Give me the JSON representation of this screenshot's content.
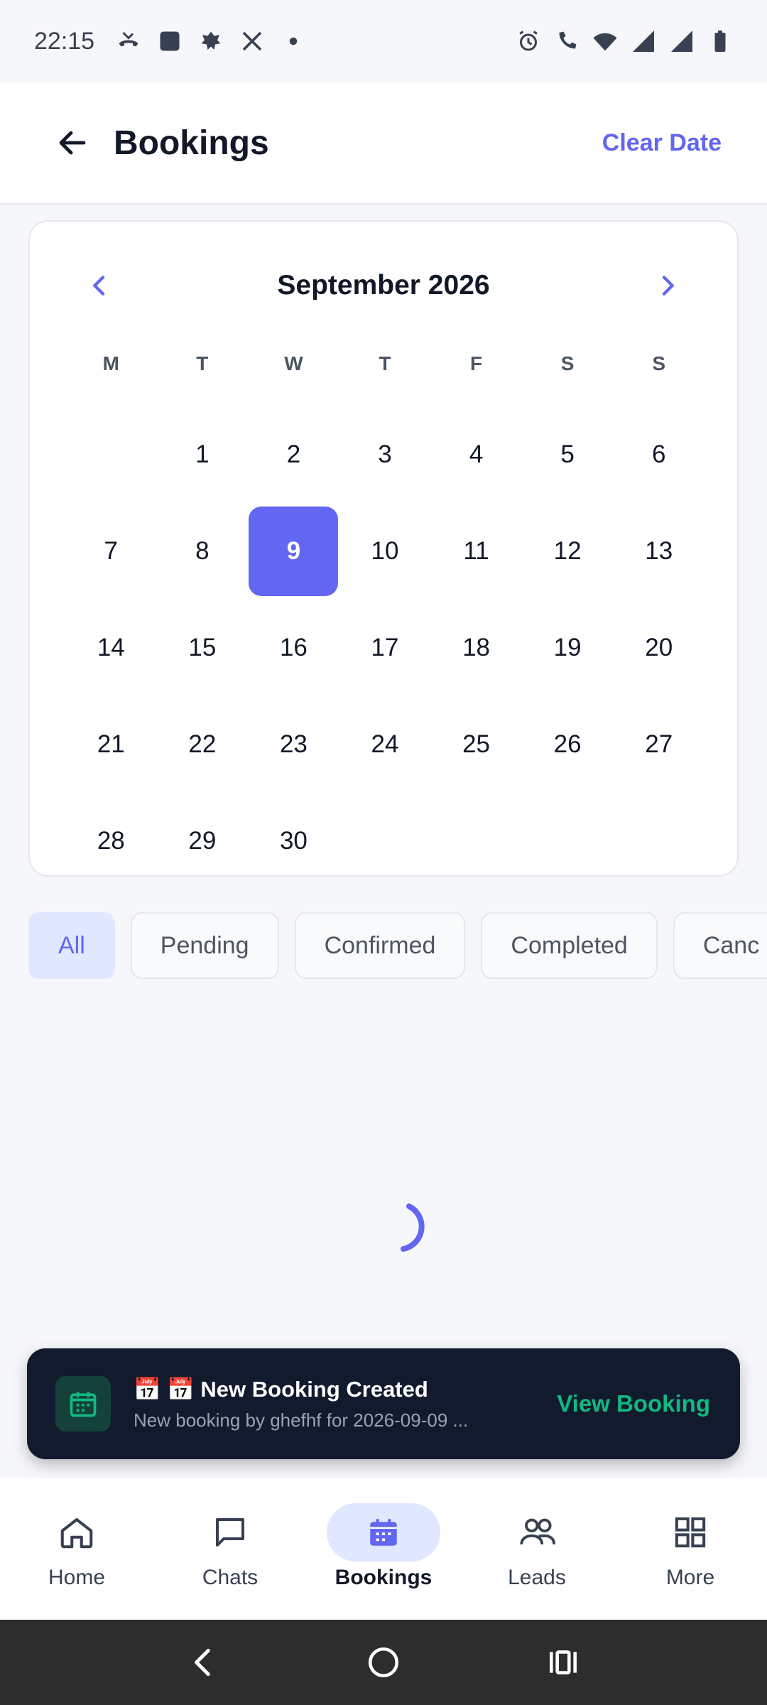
{
  "status_bar": {
    "time": "22:15",
    "left_icons": [
      "missed-call-icon",
      "app-square-icon",
      "app-leaf-icon",
      "x-logo-icon",
      "dot-icon"
    ],
    "right_icons": [
      "alarm-icon",
      "wifi-call-icon",
      "wifi-icon",
      "signal-icon",
      "signal-icon",
      "battery-icon"
    ]
  },
  "header": {
    "title": "Bookings",
    "clear_label": "Clear Date"
  },
  "calendar": {
    "title": "September 2026",
    "weekdays": [
      "M",
      "T",
      "W",
      "T",
      "F",
      "S",
      "S"
    ],
    "leading_blanks": 1,
    "days": [
      "1",
      "2",
      "3",
      "4",
      "5",
      "6",
      "7",
      "8",
      "9",
      "10",
      "11",
      "12",
      "13",
      "14",
      "15",
      "16",
      "17",
      "18",
      "19",
      "20",
      "21",
      "22",
      "23",
      "24",
      "25",
      "26",
      "27",
      "28",
      "29",
      "30"
    ],
    "selected_day": "9",
    "accent": "#6366f1"
  },
  "filters": [
    {
      "label": "All",
      "active": true
    },
    {
      "label": "Pending",
      "active": false
    },
    {
      "label": "Confirmed",
      "active": false
    },
    {
      "label": "Completed",
      "active": false
    },
    {
      "label": "Canc",
      "active": false
    }
  ],
  "snackbar": {
    "title": "📅 📅 New Booking Created",
    "subtitle": "New booking by ghefhf for 2026-09-09 ...",
    "action": "View Booking",
    "action_color": "#10b981"
  },
  "bottom_nav": [
    {
      "label": "Home",
      "icon": "home-icon",
      "active": false
    },
    {
      "label": "Chats",
      "icon": "chat-icon",
      "active": false
    },
    {
      "label": "Bookings",
      "icon": "calendar-icon",
      "active": true
    },
    {
      "label": "Leads",
      "icon": "people-icon",
      "active": false
    },
    {
      "label": "More",
      "icon": "grid-icon",
      "active": false
    }
  ]
}
